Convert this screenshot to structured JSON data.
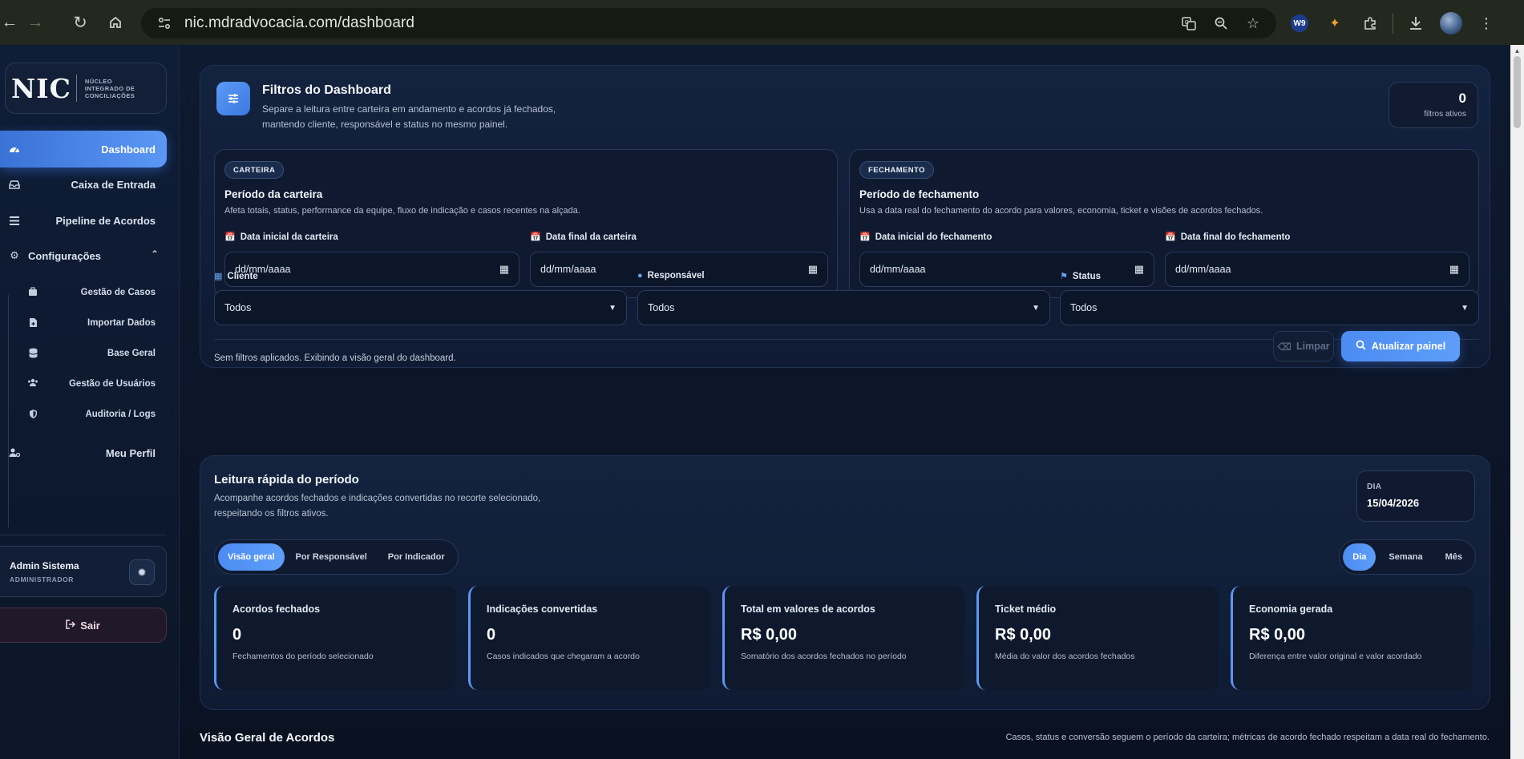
{
  "browser": {
    "url": "nic.mdradvocacia.com/dashboard"
  },
  "sidebar": {
    "logo_text": "NIC",
    "logo_subtitle": [
      "NÚCLEO",
      "INTEGRADO DE",
      "CONCILIAÇÕES"
    ],
    "items": [
      {
        "label": "Dashboard",
        "icon": "gauge-icon",
        "active": true
      },
      {
        "label": "Caixa de Entrada",
        "icon": "inbox-icon"
      },
      {
        "label": "Pipeline de Acordos",
        "icon": "list-icon"
      }
    ],
    "group": {
      "label": "Configurações",
      "icon": "gear-icon",
      "expanded": true
    },
    "sub_items": [
      {
        "label": "Gestão de Casos",
        "icon": "briefcase-icon"
      },
      {
        "label": "Importar Dados",
        "icon": "file-import-icon"
      },
      {
        "label": "Base Geral",
        "icon": "database-icon"
      },
      {
        "label": "Gestão de Usuários",
        "icon": "users-icon"
      },
      {
        "label": "Auditoria / Logs",
        "icon": "shield-icon"
      }
    ],
    "profile_item": {
      "label": "Meu Perfil",
      "icon": "user-cog-icon"
    },
    "user": {
      "name": "Admin Sistema",
      "role": "ADMINISTRADOR"
    },
    "logout_label": "Sair"
  },
  "filters": {
    "title": "Filtros do Dashboard",
    "description_line1": "Separe a leitura entre carteira em andamento e acordos já fechados,",
    "description_line2": "mantendo cliente, responsável e status no mesmo painel.",
    "active_count": "0",
    "active_label": "filtros ativos",
    "carteira": {
      "tag": "CARTEIRA",
      "title": "Período da carteira",
      "description": "Afeta totais, status, performance da equipe, fluxo de indicação e casos recentes na alçada.",
      "start_label": "Data inicial da carteira",
      "end_label": "Data final da carteira",
      "start_value": "dd/mm/aaaa",
      "end_value": "dd/mm/aaaa"
    },
    "fechamento": {
      "tag": "FECHAMENTO",
      "title": "Período de fechamento",
      "description": "Usa a data real do fechamento do acordo para valores, economia, ticket e visões de acordos fechados.",
      "start_label": "Data inicial do fechamento",
      "end_label": "Data final do fechamento",
      "start_value": "dd/mm/aaaa",
      "end_value": "dd/mm/aaaa"
    },
    "cliente": {
      "label": "Cliente",
      "value": "Todos"
    },
    "responsavel": {
      "label": "Responsável",
      "value": "Todos"
    },
    "status": {
      "label": "Status",
      "value": "Todos"
    },
    "status_text": "Sem filtros aplicados. Exibindo a visão geral do dashboard.",
    "clear_label": "Limpar",
    "refresh_label": "Atualizar painel"
  },
  "quick": {
    "title": "Leitura rápida do período",
    "description_line1": "Acompanhe acordos fechados e indicações convertidas no recorte selecionado,",
    "description_line2": "respeitando os filtros ativos.",
    "day_label": "DIA",
    "day_value": "15/04/2026",
    "view_tabs": [
      "Visão geral",
      "Por Responsável",
      "Por Indicador"
    ],
    "period_tabs": [
      "Dia",
      "Semana",
      "Mês"
    ],
    "kpis": [
      {
        "title": "Acordos fechados",
        "value": "0",
        "desc": "Fechamentos do período selecionado"
      },
      {
        "title": "Indicações convertidas",
        "value": "0",
        "desc": "Casos indicados que chegaram a acordo"
      },
      {
        "title": "Total em valores de acordos",
        "value": "R$ 0,00",
        "desc": "Somatório dos acordos fechados no período"
      },
      {
        "title": "Ticket médio",
        "value": "R$ 0,00",
        "desc": "Média do valor dos acordos fechados"
      },
      {
        "title": "Economia gerada",
        "value": "R$ 0,00",
        "desc": "Diferença entre valor original e valor acordado"
      }
    ]
  },
  "overview": {
    "title": "Visão Geral de Acordos",
    "note": "Casos, status e conversão seguem o período da carteira; métricas de acordo fechado respeitam a data real do fechamento."
  },
  "colors": {
    "accent": "#5b98f5",
    "background": "#0c1526",
    "panel": "#13223e"
  }
}
